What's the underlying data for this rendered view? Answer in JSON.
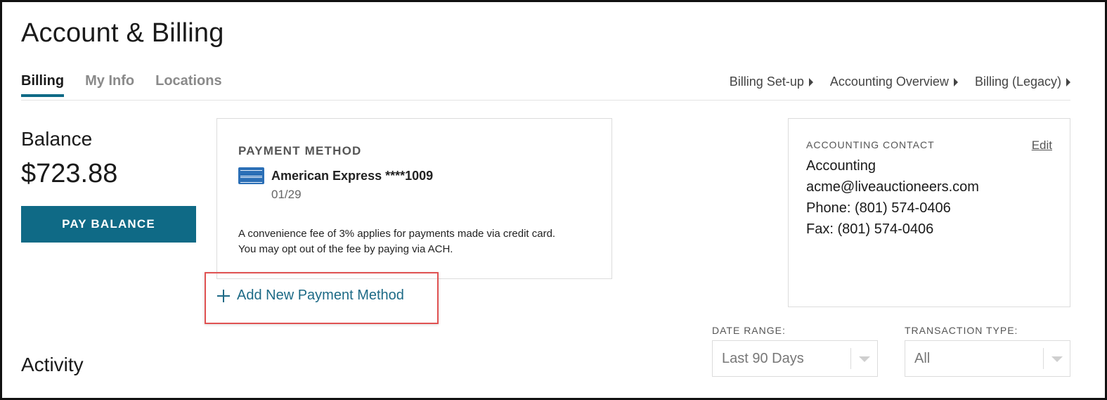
{
  "page": {
    "title": "Account & Billing"
  },
  "tabs": [
    {
      "label": "Billing",
      "active": true
    },
    {
      "label": "My Info",
      "active": false
    },
    {
      "label": "Locations",
      "active": false
    }
  ],
  "top_links": [
    {
      "label": "Billing Set-up"
    },
    {
      "label": "Accounting Overview"
    },
    {
      "label": "Billing (Legacy)"
    }
  ],
  "balance": {
    "label": "Balance",
    "amount": "$723.88",
    "pay_button": "PAY BALANCE"
  },
  "payment_method": {
    "heading": "PAYMENT METHOD",
    "card_brand_icon": "amex-card-icon",
    "card_name": "American Express ****1009",
    "expiry": "01/29",
    "fee_line1": "A convenience fee of 3% applies for payments made via credit card.",
    "fee_line2": "You may opt out of the fee by paying via ACH.",
    "add_label": "Add New Payment Method",
    "highlight_color": "#e05252"
  },
  "accounting_contact": {
    "heading": "ACCOUNTING CONTACT",
    "edit_label": "Edit",
    "name": "Accounting",
    "email": "acme@liveauctioneers.com",
    "phone": "Phone: (801) 574-0406",
    "fax": "Fax: (801) 574-0406"
  },
  "filters": {
    "date_range": {
      "label": "DATE RANGE:",
      "value": "Last 90 Days"
    },
    "transaction_type": {
      "label": "TRANSACTION TYPE:",
      "value": "All"
    }
  },
  "activity": {
    "heading": "Activity"
  },
  "colors": {
    "accent": "#0f6a86",
    "link": "#1d6a86"
  }
}
